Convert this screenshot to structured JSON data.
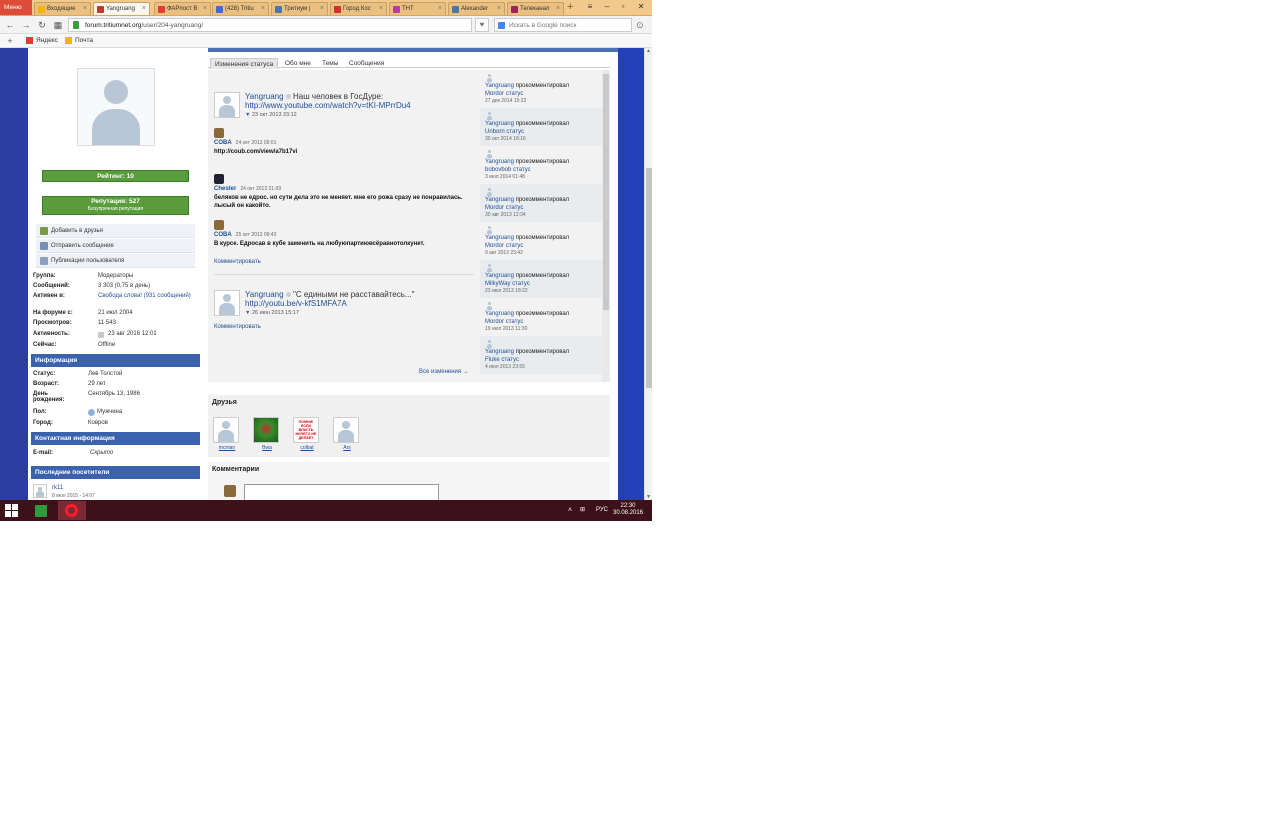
{
  "browser": {
    "menu_label": "Меню",
    "tabs": [
      {
        "label": "Входящие",
        "color": "#f4b400",
        "active": false
      },
      {
        "label": "Yangruang",
        "color": "#c0392b",
        "active": true
      },
      {
        "label": "ФАРпост В",
        "color": "#e53935",
        "active": false
      },
      {
        "label": "(428) Tritiu",
        "color": "#3f6ec2",
        "active": false
      },
      {
        "label": "Тритиум |",
        "color": "#4a76a8",
        "active": false
      },
      {
        "label": "Город Кос",
        "color": "#d32f2f",
        "active": false
      },
      {
        "label": "ТНТ",
        "color": "#b43fa0",
        "active": false
      },
      {
        "label": "Alexander",
        "color": "#4a76a8",
        "active": false
      },
      {
        "label": "Телеканал",
        "color": "#a02060",
        "active": false
      }
    ],
    "new_tab": "+",
    "url_host": "forum.tritiumnet.org",
    "url_path": "/user/204-yangruang/",
    "search_placeholder": "Искать в Google поиск",
    "bookmarks": [
      {
        "label": "Яндекс",
        "color": "#e53935"
      },
      {
        "label": "Почта",
        "color": "#f4b400"
      }
    ]
  },
  "profile": {
    "rating": "Рейтинг: 10",
    "reputation": "Репутация: 527",
    "reputation_sub": "Безупречная репутация",
    "actions": [
      {
        "label": "Добавить в друзья",
        "color": "#7a9a4a"
      },
      {
        "label": "Отправить сообщение",
        "color": "#7a8fb0"
      },
      {
        "label": "Публикации пользователя",
        "color": "#8aa0c0"
      }
    ],
    "stats": [
      {
        "key": "Группа:",
        "value": "Модераторы"
      },
      {
        "key": "Сообщений:",
        "value": "3 303 (0,75 в день)"
      },
      {
        "key": "Активен в:",
        "value": "Свобода слова! (931 сообщений)"
      },
      {
        "key": "На форуме с:",
        "value": "21 июл 2004"
      },
      {
        "key": "Просмотров:",
        "value": "11 543"
      },
      {
        "key": "Активность:",
        "value": "23 авг 2016 12:01"
      },
      {
        "key": "Сейчас:",
        "value": "Offline"
      }
    ],
    "info_header": "Информация",
    "info": [
      {
        "key": "Статус:",
        "value": "Лев Толстой"
      },
      {
        "key": "Возраст:",
        "value": "29 лет"
      },
      {
        "key": "День рождения:",
        "value": "Сентябрь 13, 1986"
      },
      {
        "key": "Пол:",
        "value": "Мужчина"
      },
      {
        "key": "Город:",
        "value": "Ковров"
      }
    ],
    "contact_header": "Контактная информация",
    "contact": [
      {
        "key": "E-mail:",
        "value": "Скрыто"
      }
    ],
    "visitors_header": "Последние посетители",
    "visitors": [
      {
        "name": "rk11",
        "date": "8 июл 2015 - 14:07"
      }
    ]
  },
  "main": {
    "tabs": [
      "Изменения статуса",
      "Обо мне",
      "Темы",
      "Сообщения"
    ],
    "posts": [
      {
        "user": "Yangruang",
        "text": "Наш человек в ГосДуре:",
        "link": "http://www.youtube.com/watch?v=tKI-MPrrDu4",
        "date": "23 окт 2013 23:12",
        "comments": [
          {
            "user": "COBA",
            "date": "24 окт 2013 09:01",
            "text": "http://coub.com/view/a7b17vi",
            "color": "#8a6a3a"
          },
          {
            "user": "Chester",
            "date": "24 окт 2013 21:09",
            "text": "беляков не едрос. но сути дела это не меняет. мне его рожа сразу не понравилась. лысый он какойто.",
            "color": "#222233"
          },
          {
            "user": "COBA",
            "date": "25 окт 2013 09:43",
            "text": "В курсе. Едросав в кубе заменить на любуюпартиювсёравнотолкунет.",
            "color": "#8a6a3a"
          }
        ],
        "comment_link": "Комментировать"
      },
      {
        "user": "Yangruang",
        "text": "\"С едиными не расставайтесь...\"",
        "link": "http://youtu.be/v-kfS1MFA7A",
        "date": "26 июн 2013 15:17",
        "comments": [],
        "comment_link": "Комментировать"
      }
    ],
    "all_changes": "Все изменения →",
    "activity": [
      {
        "user": "Yangruang",
        "verb": "прокомментировал",
        "target": "Mordor",
        "obj": "статус",
        "date": "27 дек 2014 15:22"
      },
      {
        "user": "Yangruang",
        "verb": "прокомментировал",
        "target": "Unborn",
        "obj": "статус",
        "date": "30 окт 2014 18:16"
      },
      {
        "user": "Yangruang",
        "verb": "прокомментировал",
        "target": "bobovbob",
        "obj": "статус",
        "date": "3 июл 2014 01:48"
      },
      {
        "user": "Yangruang",
        "verb": "прокомментировал",
        "target": "Mordor",
        "obj": "статус",
        "date": "30 авг 2013 12:34"
      },
      {
        "user": "Yangruang",
        "verb": "прокомментировал",
        "target": "Mordor",
        "obj": "статус",
        "date": "9 авг 2013 23:42"
      },
      {
        "user": "Yangruang",
        "verb": "прокомментировал",
        "target": "MilkyWay",
        "obj": "статус",
        "date": "23 июл 2013 18:22"
      },
      {
        "user": "Yangruang",
        "verb": "прокомментировал",
        "target": "Mordor",
        "obj": "статус",
        "date": "19 июл 2013 11:30"
      },
      {
        "user": "Yangruang",
        "verb": "прокомментировал",
        "target": "Fluke",
        "obj": "статус",
        "date": "4 июл 2013 23:55"
      }
    ],
    "friends_header": "Друзья",
    "friends": [
      {
        "name": "mcman",
        "style": "silhouette"
      },
      {
        "name": "Bwa",
        "style": "green"
      },
      {
        "name": "colbat",
        "style": "poster"
      },
      {
        "name": "Ars",
        "style": "silhouette"
      }
    ],
    "friend_poster_text": "ПОМНИ! ЕСЛИ ВЛАСТЬ НИЧЕГО НЕ ДЕЛАЕТ",
    "comments_header": "Комментарии"
  },
  "taskbar": {
    "lang": "РУС",
    "time": "22:30",
    "date": "30.08.2016"
  }
}
